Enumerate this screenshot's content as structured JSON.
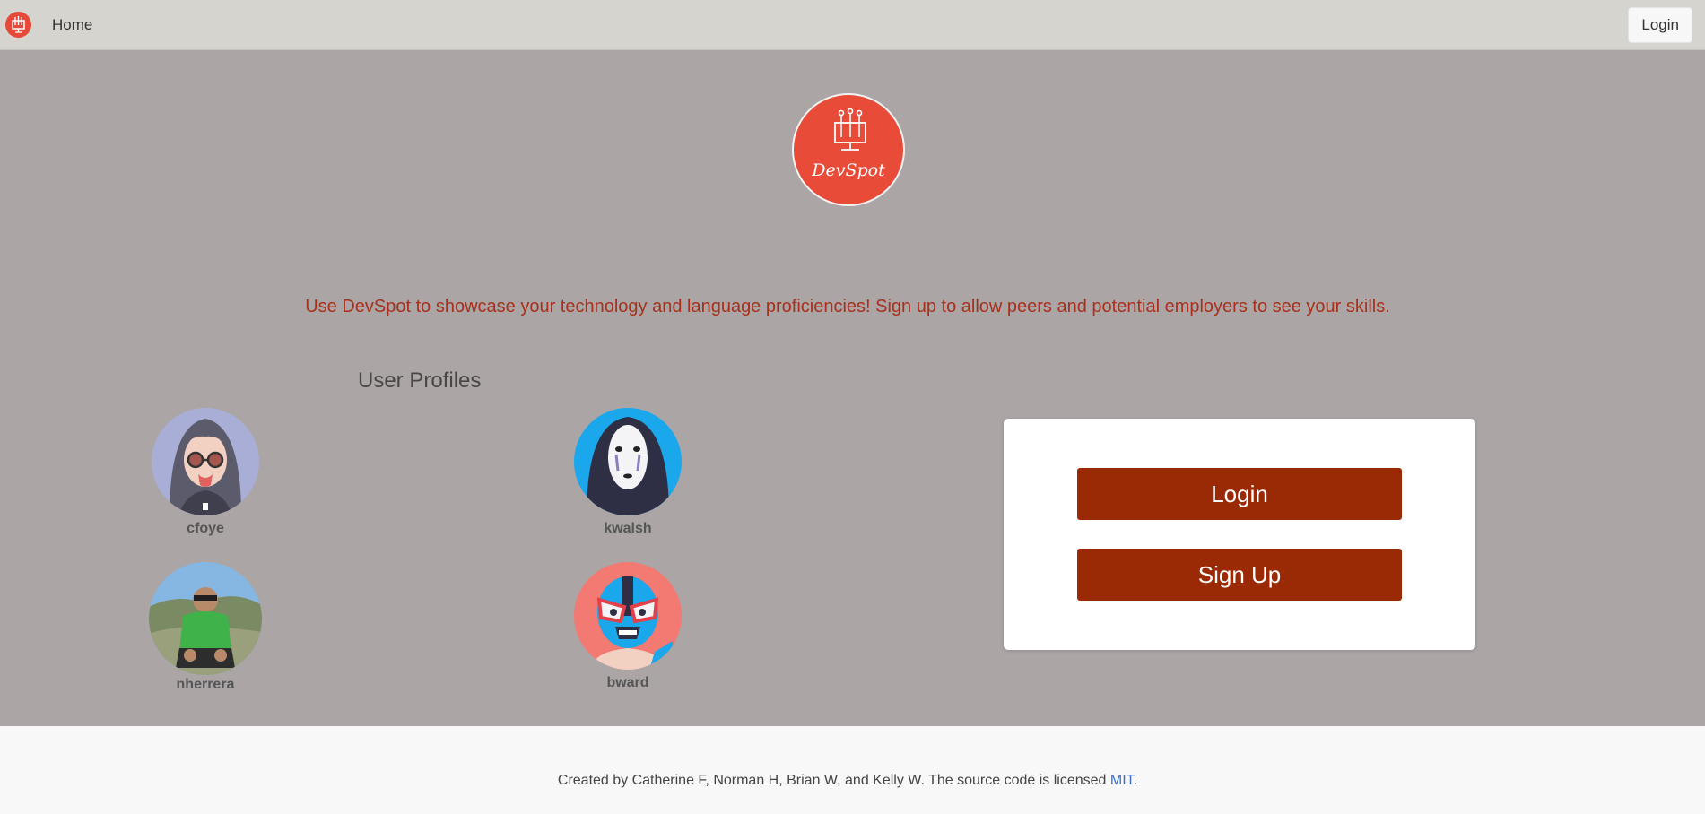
{
  "navbar": {
    "home_label": "Home",
    "login_label": "Login",
    "logo_icon": "devspot-logo-icon"
  },
  "hero": {
    "brand": "DevSpot",
    "tagline": "Use DevSpot to showcase your technology and language proficiencies! Sign up to allow peers and potential employers to see your skills."
  },
  "profiles": {
    "title": "User Profiles",
    "users": [
      {
        "username": "cfoye"
      },
      {
        "username": "kwalsh"
      },
      {
        "username": "nherrera"
      },
      {
        "username": "bward"
      }
    ]
  },
  "auth": {
    "login_label": "Login",
    "signup_label": "Sign Up"
  },
  "footer": {
    "text_before": "Created by Catherine F, Norman H, Brian W, and Kelly W. The source code is licensed ",
    "link_label": "MIT",
    "text_after": "."
  },
  "colors": {
    "brand_red": "#e84b37",
    "button_red": "#9a2a05",
    "tagline_red": "#a8301c",
    "page_bg": "#aba5a5",
    "navbar_bg": "#d5d4ce"
  }
}
